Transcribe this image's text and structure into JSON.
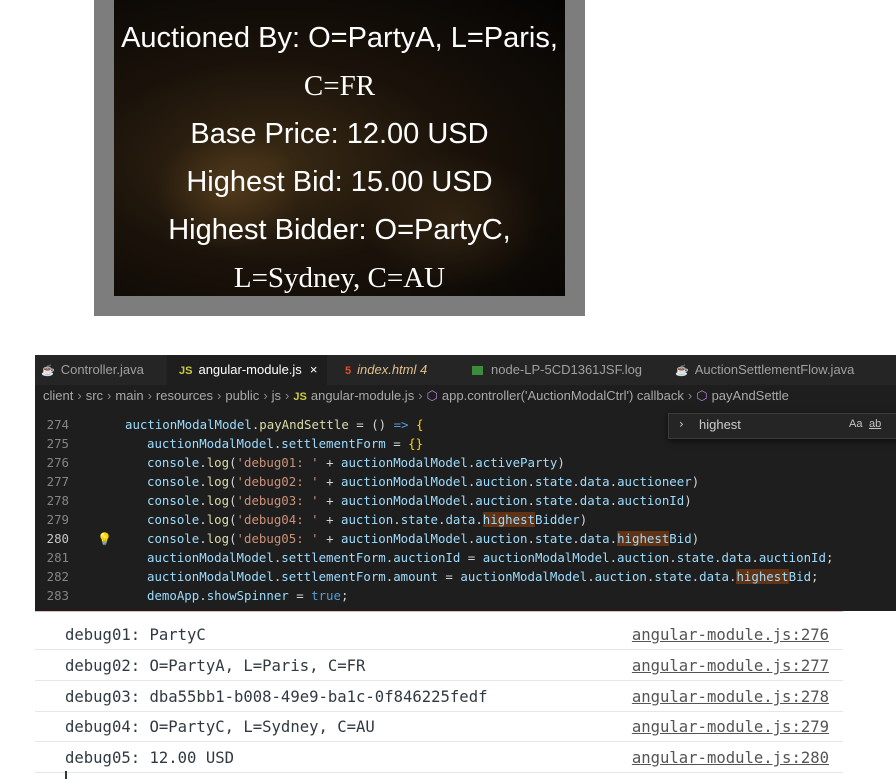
{
  "auction_card": {
    "line1": "Auctioned By: O=PartyA, L=Paris,",
    "line2": "C=FR",
    "line3": "Base Price: 12.00 USD",
    "line4": "Highest Bid: 15.00 USD",
    "line5": "Highest Bidder: O=PartyC,",
    "line6": "L=Sydney, C=AU"
  },
  "editor": {
    "tabs": [
      {
        "label": "Controller.java",
        "icon": "java-icon"
      },
      {
        "label": "angular-module.js",
        "icon": "js-icon",
        "active": true,
        "close": "×"
      },
      {
        "label": "index.html",
        "badge": "4",
        "icon": "html-icon"
      },
      {
        "label": "node-LP-5CD1361JSF.log",
        "icon": "log-icon"
      },
      {
        "label": "AuctionSettlementFlow.java",
        "icon": "java-icon"
      }
    ],
    "breadcrumb": {
      "client": "client",
      "src": "src",
      "main": "main",
      "resources": "resources",
      "public": "public",
      "js": "js",
      "file": "angular-module.js",
      "controller": "app.controller('AuctionModalCtrl') callback",
      "method": "payAndSettle"
    },
    "find": {
      "value": "highest",
      "match_case": "Aa",
      "whole_word": "ab"
    },
    "line_numbers": [
      "274",
      "275",
      "276",
      "277",
      "278",
      "279",
      "280",
      "281",
      "282",
      "283"
    ],
    "current_line": "280"
  },
  "console": {
    "rows": [
      {
        "message": "debug01: PartyC",
        "location": "angular-module.js:276"
      },
      {
        "message": "debug02: O=PartyA, L=Paris, C=FR",
        "location": "angular-module.js:277"
      },
      {
        "message": "debug03: dba55bb1-b008-49e9-ba1c-0f846225fedf",
        "location": "angular-module.js:278"
      },
      {
        "message": "debug04: O=PartyC, L=Sydney, C=AU",
        "location": "angular-module.js:279"
      },
      {
        "message": "debug05: 12.00 USD",
        "location": "angular-module.js:280"
      }
    ]
  }
}
